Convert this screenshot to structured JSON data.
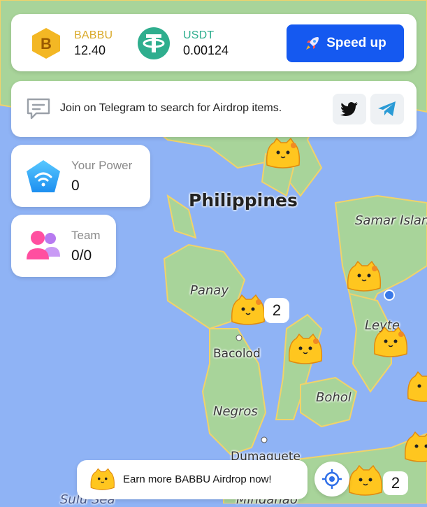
{
  "balances": [
    {
      "symbol": "BABBU",
      "amount": "12.40",
      "color": "#d9a928",
      "icon": "babbu-coin-icon"
    },
    {
      "symbol": "USDT",
      "amount": "0.00124",
      "color": "#2fae8e",
      "icon": "usdt-coin-icon"
    }
  ],
  "speed_up": {
    "label": "Speed up",
    "icon": "rocket-icon",
    "color": "#1559f0"
  },
  "telegram_banner": {
    "text": "Join on Telegram to search for Airdrop items.",
    "icon": "chat-bubble-icon"
  },
  "social": [
    {
      "icon": "twitter-icon"
    },
    {
      "icon": "telegram-icon"
    }
  ],
  "power": {
    "label": "Your Power",
    "value": "0",
    "icon": "wifi-shield-icon"
  },
  "team": {
    "label": "Team",
    "value": "0/0",
    "icon": "team-icon"
  },
  "map_labels": {
    "country": "Philippines",
    "samar": "Samar Island",
    "panay": "Panay",
    "bacolod": "Bacolod",
    "leyte": "Leyte",
    "negros": "Negros",
    "bohol": "Bohol",
    "dumaguete": "Dumaguete",
    "sulu": "Sulu Sea",
    "mindanao": "Mindanao"
  },
  "cluster_counts": [
    "2",
    "2"
  ],
  "earn_banner": {
    "text": "Earn more BABBU Airdrop now!",
    "icon": "babbu-mascot-icon"
  },
  "locate_button": {
    "icon": "locate-icon"
  }
}
